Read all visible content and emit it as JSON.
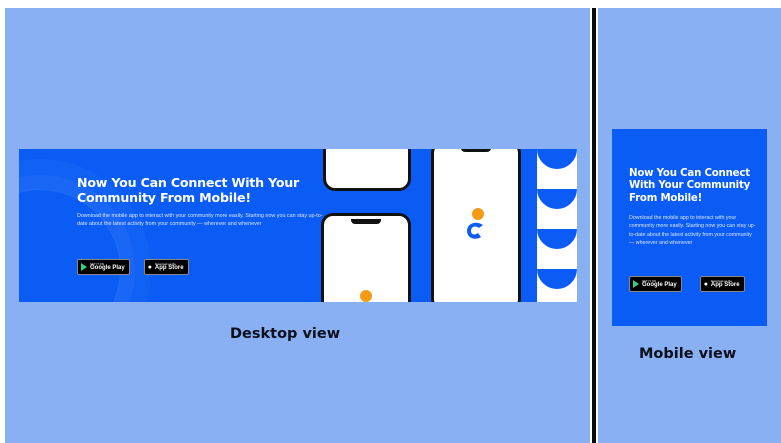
{
  "banner": {
    "title": "Now You Can Connect With Your Community From Mobile!",
    "body": "Download the mobile app to interact with your community more easily. Starting now you can stay up-to-date about the latest activity from your community — wherever and whenever",
    "google_play": {
      "small": "GET IT ON",
      "big": "Google Play"
    },
    "app_store": {
      "small": "Download on the",
      "big": "App Store"
    }
  },
  "labels": {
    "desktop": "Desktop view",
    "mobile": "Mobile view"
  },
  "colors": {
    "background": "#8ab0f4",
    "banner": "#0a5cf5",
    "accent": "#f59a16"
  },
  "icons": [
    "google-play-icon",
    "apple-icon",
    "app-logo-icon"
  ]
}
